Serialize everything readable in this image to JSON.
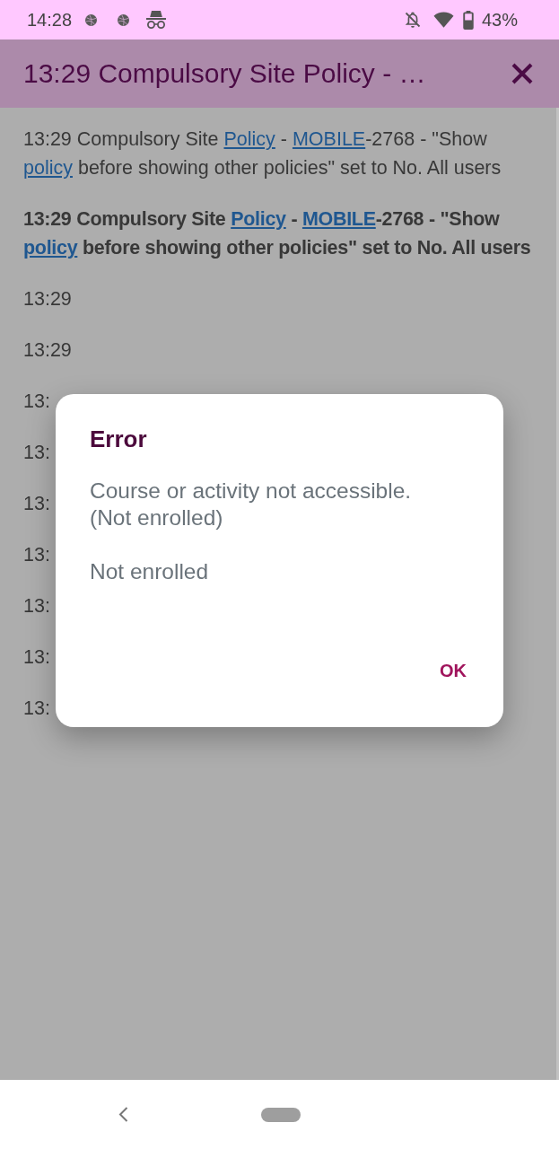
{
  "status_bar": {
    "time": "14:28",
    "battery": "43%"
  },
  "header": {
    "title": "13:29 Compulsory Site Policy - …"
  },
  "entries": [
    {
      "bold": false,
      "parts": [
        {
          "kind": "text",
          "text": "13:29 Compulsory Site "
        },
        {
          "kind": "link",
          "text": "Policy"
        },
        {
          "kind": "text",
          "text": " - "
        },
        {
          "kind": "link",
          "text": "MOBILE"
        },
        {
          "kind": "text",
          "text": "-2768 - \"Show "
        },
        {
          "kind": "link",
          "text": "policy"
        },
        {
          "kind": "text",
          "text": " before showing other policies\" set to No. All users"
        }
      ]
    },
    {
      "bold": true,
      "parts": [
        {
          "kind": "text",
          "text": "13:29 Compulsory Site "
        },
        {
          "kind": "link",
          "text": "Policy"
        },
        {
          "kind": "text",
          "text": " - "
        },
        {
          "kind": "link",
          "text": "MOBILE"
        },
        {
          "kind": "text",
          "text": "-2768 - \"Show "
        },
        {
          "kind": "link",
          "text": "policy"
        },
        {
          "kind": "text",
          "text": " before showing other policies\" set to No. All users"
        }
      ]
    },
    {
      "bold": false,
      "parts": [
        {
          "kind": "text",
          "text": "13:29"
        }
      ]
    },
    {
      "bold": false,
      "parts": [
        {
          "kind": "text",
          "text": "13:29"
        }
      ]
    },
    {
      "bold": false,
      "parts": [
        {
          "kind": "text",
          "text": "13:"
        }
      ]
    },
    {
      "bold": false,
      "parts": [
        {
          "kind": "text",
          "text": "13:"
        }
      ]
    },
    {
      "bold": false,
      "parts": [
        {
          "kind": "text",
          "text": "13:"
        }
      ]
    },
    {
      "bold": false,
      "parts": [
        {
          "kind": "text",
          "text": "13:"
        }
      ]
    },
    {
      "bold": false,
      "parts": [
        {
          "kind": "text",
          "text": "13:"
        }
      ]
    },
    {
      "bold": false,
      "parts": [
        {
          "kind": "text",
          "text": "13:"
        }
      ]
    },
    {
      "bold": false,
      "parts": [
        {
          "kind": "text",
          "text": "13:"
        }
      ]
    }
  ],
  "dialog": {
    "title": "Error",
    "message": "Course or activity not accessible. (Not enrolled)",
    "detail": "Not enrolled",
    "buttons": [
      "OK"
    ]
  }
}
